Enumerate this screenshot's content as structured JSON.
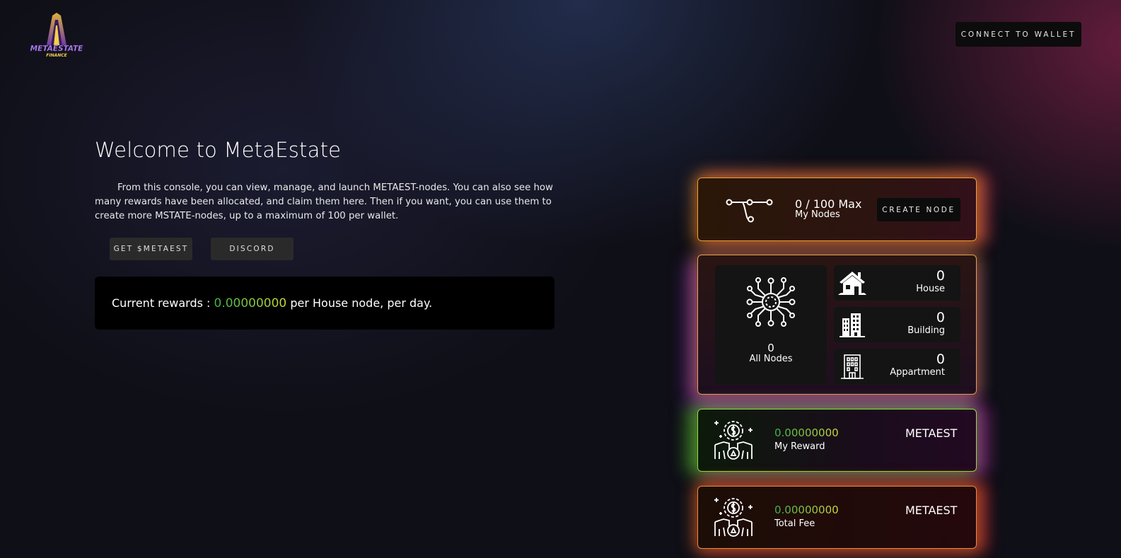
{
  "header": {
    "logo_text": "METAESTATE",
    "logo_sub": "FINANCE",
    "connect_label": "CONNECT TO WALLET"
  },
  "intro": {
    "title": "Welcome to MetaEstate",
    "paragraph": "From this console, you can view, manage, and launch METAEST-nodes. You can also see how many rewards have been allocated, and claim them here. Then if you want, you can use them to create more MSTATE-nodes, up to a maximum of 100 per wallet.",
    "get_label": "GET $METAEST",
    "discord_label": "DISCORD"
  },
  "rewards": {
    "prefix": "Current rewards :",
    "value": "0.00000000",
    "suffix": "per House node, per day."
  },
  "my_nodes": {
    "count": "0 / 100 Max",
    "label": "My Nodes",
    "create_label": "CREATE NODE"
  },
  "node_counts": {
    "all": {
      "count": "0",
      "label": "All Nodes"
    },
    "house": {
      "count": "0",
      "label": "House"
    },
    "building": {
      "count": "0",
      "label": "Building"
    },
    "appartment": {
      "count": "0",
      "label": "Appartment"
    }
  },
  "my_reward": {
    "value": "0.00000000",
    "label": "My Reward",
    "unit": "METAEST"
  },
  "total_fee": {
    "value": "0.00000000",
    "label": "Total Fee",
    "unit": "METAEST"
  },
  "icons": [
    "logo-icon",
    "route-icon",
    "network-icon",
    "house-icon",
    "building-icon",
    "apartment-icon",
    "reward-icon"
  ],
  "colors": {
    "reward_gradient_start": "#3bb34a",
    "reward_gradient_end": "#d5dc3a",
    "nodes_card_border": "#f0a030",
    "reward_card_border": "#8fe03a"
  }
}
